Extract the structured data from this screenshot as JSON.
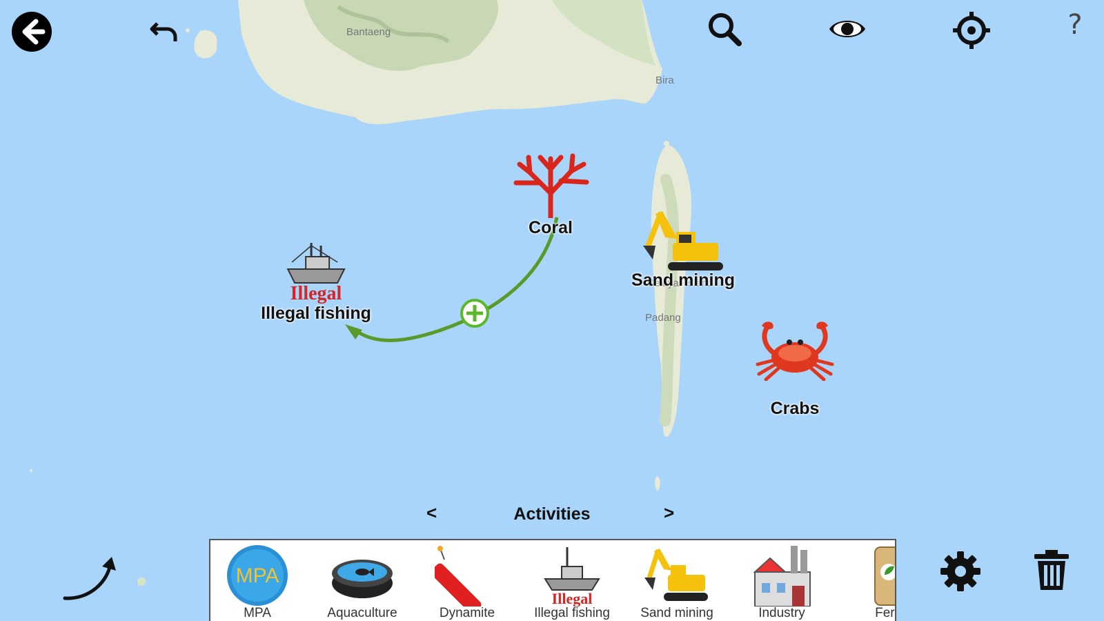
{
  "toolbar": {
    "back": "back-icon",
    "undo": "undo-icon",
    "search": "search-icon",
    "view": "eye-icon",
    "locate": "crosshair-icon",
    "help": "?"
  },
  "map": {
    "labels": [
      "Bantaeng",
      "Bira",
      "Selayar Island",
      "Padang"
    ]
  },
  "nodes": {
    "coral": "Coral",
    "sand_mining": "Sand mining",
    "illegal_fishing": "Illegal fishing",
    "illegal_stamp": "Illegal",
    "crabs": "Crabs"
  },
  "link": {
    "color": "#5a9a2a",
    "add_icon": "plus-circle-icon"
  },
  "activities": {
    "prev": "<",
    "title": "Activities",
    "next": ">",
    "items": [
      {
        "label": "MPA",
        "icon_text": "MPA"
      },
      {
        "label": "Aquaculture"
      },
      {
        "label": "Dynamite"
      },
      {
        "label": "Illegal fishing",
        "icon_text": "Illegal"
      },
      {
        "label": "Sand mining"
      },
      {
        "label": "Industry"
      },
      {
        "label": "Fert"
      }
    ]
  },
  "bottom_tools": {
    "link": "curved-arrow-icon",
    "settings": "gear-icon",
    "delete": "trash-icon"
  },
  "colors": {
    "water": "#a9d5fa",
    "land": "#e8ecd8",
    "accent_link": "#5a9a2a"
  }
}
